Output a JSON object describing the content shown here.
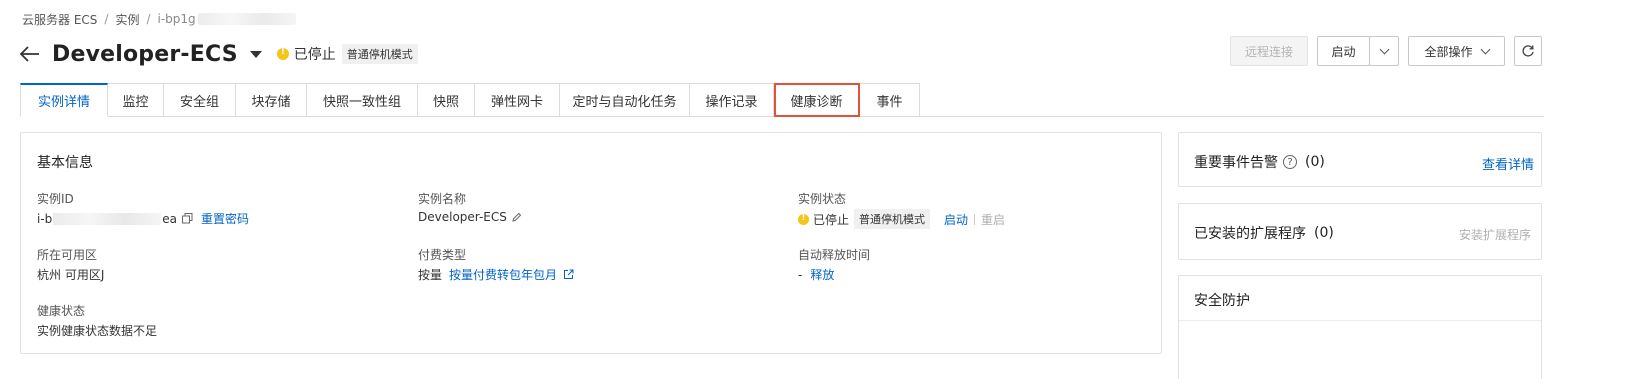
{
  "breadcrumb": {
    "items": [
      "云服务器 ECS",
      "实例",
      "i-bp1g"
    ]
  },
  "header": {
    "title": "Developer-ECS",
    "status": "已停止",
    "mode_tag": "普通停机模式"
  },
  "actions": {
    "remote_connect": "远程连接",
    "start": "启动",
    "all_actions": "全部操作"
  },
  "tabs": [
    {
      "label": "实例详情",
      "active": true
    },
    {
      "label": "监控"
    },
    {
      "label": "安全组"
    },
    {
      "label": "块存储"
    },
    {
      "label": "快照一致性组"
    },
    {
      "label": "快照"
    },
    {
      "label": "弹性网卡"
    },
    {
      "label": "定时与自动化任务"
    },
    {
      "label": "操作记录"
    },
    {
      "label": "健康诊断",
      "highlighted": true
    },
    {
      "label": "事件"
    }
  ],
  "basic_info": {
    "title": "基本信息",
    "instance_id_label": "实例ID",
    "instance_id_prefix": "i-b",
    "instance_id_suffix": "ea",
    "reset_password": "重置密码",
    "instance_name_label": "实例名称",
    "instance_name": "Developer-ECS",
    "instance_status_label": "实例状态",
    "instance_status": "已停止",
    "instance_status_tag": "普通停机模式",
    "start_link": "启动",
    "restart_link": "重启",
    "zone_label": "所在可用区",
    "zone": "杭州 可用区J",
    "billing_label": "付费类型",
    "billing_type": "按量",
    "billing_convert": "按量付费转包年包月",
    "auto_release_label": "自动释放时间",
    "auto_release_value": "-",
    "release_link": "释放",
    "health_label": "健康状态",
    "health_value": "实例健康状态数据不足"
  },
  "side": {
    "events_title": "重要事件告警",
    "events_count": "(0)",
    "events_link": "查看详情",
    "extensions_title": "已安装的扩展程序",
    "extensions_count": "(0)",
    "extensions_link": "安装扩展程序",
    "security_title": "安全防护"
  },
  "colors": {
    "accent": "#0064c8",
    "status_warning": "#f5c518",
    "highlight_border": "#e2543a"
  },
  "icons": [
    "back-arrow-icon",
    "dropdown-caret-icon",
    "warning-dot-icon",
    "chevron-down-icon",
    "refresh-icon",
    "copy-icon",
    "edit-icon",
    "external-link-icon",
    "help-icon"
  ]
}
